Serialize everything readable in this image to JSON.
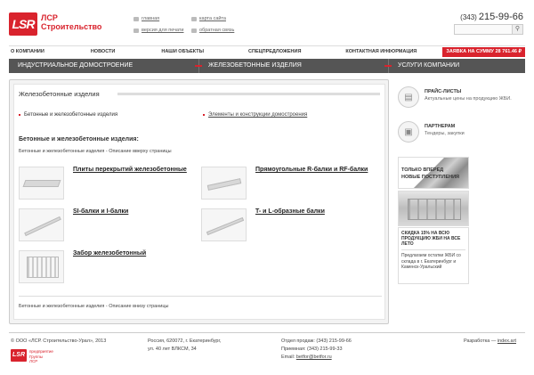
{
  "header": {
    "logo_mark": "LSR",
    "logo_line1": "ЛСР",
    "logo_line2": "Строительство",
    "links": [
      "главная",
      "карта сайта",
      "версия для печати",
      "обратная связь"
    ],
    "phone_code": "(343)",
    "phone_number": "215-99-66",
    "search_placeholder": ""
  },
  "nav_top": [
    "О КОМПАНИИ",
    "НОВОСТИ",
    "НАШИ ОБЪЕКТЫ",
    "СПЕЦПРЕДЛОЖЕНИЯ",
    "КОНТАКТНАЯ ИНФОРМАЦИЯ"
  ],
  "promo": "ЗАЯВКА НА СУММУ 28 761.46 ₽",
  "nav_main": [
    "ИНДУСТРИАЛЬНОЕ ДОМОСТРОЕНИЕ",
    "ЖЕЛЕЗОБЕТОННЫЕ ИЗДЕЛИЯ",
    "УСЛУГИ КОМПАНИИ"
  ],
  "main": {
    "title": "Железобетонные изделия",
    "bullet_current": "Бетонные и железобетонные изделия",
    "bullet_link": "Элементы и конструкции домостроения",
    "subhead": "Бетонные и железобетонные изделия:",
    "desc_top": "Бетонные и железобетонные изделия - Описание вверху страницы",
    "products": [
      "Плиты перекрытий железобетонные",
      "Прямоугольные R-балки и RF-балки",
      "SI-балки и I-балки",
      "T- и L-образные балки",
      "Забор железобетонный"
    ],
    "desc_bottom": "Бетонные и железобетонные изделия - Описание внизу страницы"
  },
  "sidebar": {
    "price_title": "ПРАЙС-ЛИСТЫ",
    "price_sub": "Актуальные цены на продукцию ЖБИ.",
    "partners_title": "ПАРТНЕРАМ",
    "partners_sub": "Тендеры, закупки",
    "banner1_line1": "ТОЛЬКО ВПЕРЕД",
    "banner1_line2": "НОВЫЕ ПОСТУПЛЕНИЯ",
    "box_title": "СКИДКА 15% НА ВСЮ ПРОДУКЦИЮ ЖБИ НА ВСЕ ЛЕТО",
    "box_desc": "Предлагаем остатки ЖБИ со склада в г. Екатеринбург и Каменск-Уральский"
  },
  "footer": {
    "copyright": "© ООО «ЛСР. Строительство-Урал», 2013",
    "logo_mark": "LSR",
    "logo_text1": "предприятие",
    "logo_text2": "Группы",
    "logo_text3": "ЛСР",
    "address1": "Россия, 620072, г. Екатеринбург,",
    "address2": "ул. 40 лет ВЛКСМ, 34",
    "sales": "Отдел продаж: (343) 215-99-66",
    "reception": "Приемная: (343) 215-99-33",
    "email_label": "Email:",
    "email": "betfor@betfor.ru",
    "dev_label": "Разработка —",
    "dev_link": "index.art"
  },
  "colors": {
    "brand": "#d9232d",
    "nav": "#555555"
  }
}
